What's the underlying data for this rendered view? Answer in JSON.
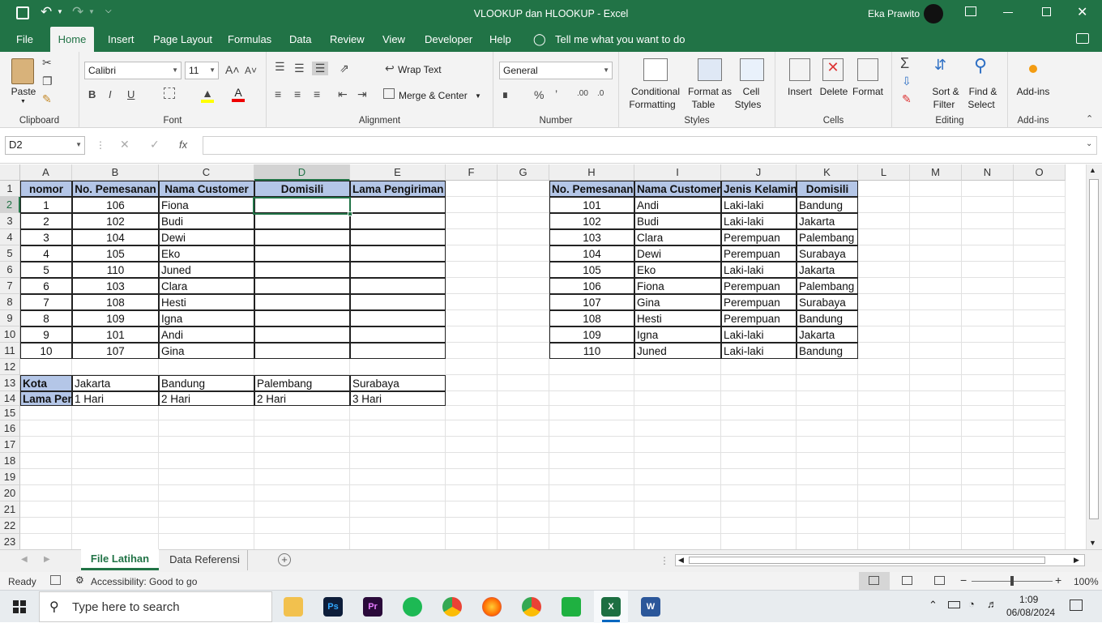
{
  "window": {
    "title": "VLOOKUP dan HLOOKUP  -  Excel",
    "user": "Eka Prawito"
  },
  "ribbon_tabs": [
    "File",
    "Home",
    "Insert",
    "Page Layout",
    "Formulas",
    "Data",
    "Review",
    "View",
    "Developer",
    "Help"
  ],
  "tell_me": "Tell me what you want to do",
  "ribbon": {
    "clipboard": {
      "label": "Clipboard",
      "paste": "Paste"
    },
    "font": {
      "label": "Font",
      "name": "Calibri",
      "size": "11",
      "bold": "B",
      "italic": "I",
      "underline": "U"
    },
    "alignment": {
      "label": "Alignment",
      "wrap": "Wrap Text",
      "merge": "Merge & Center"
    },
    "number": {
      "label": "Number",
      "format": "General"
    },
    "styles": {
      "label": "Styles",
      "conditional": [
        "Conditional",
        "Formatting"
      ],
      "format_table": [
        "Format as",
        "Table"
      ],
      "cell_styles": [
        "Cell",
        "Styles"
      ]
    },
    "cells": {
      "label": "Cells",
      "insert": "Insert",
      "delete": "Delete",
      "format": "Format"
    },
    "editing": {
      "label": "Editing",
      "sort": [
        "Sort &",
        "Filter"
      ],
      "find": [
        "Find &",
        "Select"
      ]
    },
    "addins": {
      "label": "Add-ins",
      "button": "Add-ins"
    }
  },
  "formula_bar": {
    "name_box": "D2",
    "fx": "fx",
    "value": ""
  },
  "columns": [
    "A",
    "B",
    "C",
    "D",
    "E",
    "F",
    "G",
    "H",
    "I",
    "J",
    "K",
    "L",
    "M",
    "N",
    "O"
  ],
  "rows": [
    "1",
    "2",
    "3",
    "4",
    "5",
    "6",
    "7",
    "8",
    "9",
    "10",
    "11",
    "12",
    "13",
    "14",
    "15",
    "16",
    "17",
    "18",
    "19",
    "20",
    "21",
    "22",
    "23"
  ],
  "table1": {
    "headers": [
      "nomor",
      "No. Pemesanan",
      "Nama Customer",
      "Domisili",
      "Lama Pengiriman"
    ],
    "rows": [
      [
        "1",
        "106",
        "Fiona",
        "",
        ""
      ],
      [
        "2",
        "102",
        "Budi",
        "",
        ""
      ],
      [
        "3",
        "104",
        "Dewi",
        "",
        ""
      ],
      [
        "4",
        "105",
        "Eko",
        "",
        ""
      ],
      [
        "5",
        "110",
        "Juned",
        "",
        ""
      ],
      [
        "6",
        "103",
        "Clara",
        "",
        ""
      ],
      [
        "7",
        "108",
        "Hesti",
        "",
        ""
      ],
      [
        "8",
        "109",
        "Igna",
        "",
        ""
      ],
      [
        "9",
        "101",
        "Andi",
        "",
        ""
      ],
      [
        "10",
        "107",
        "Gina",
        "",
        ""
      ]
    ]
  },
  "table2": {
    "headers": [
      "No. Pemesanan",
      "Nama Customer",
      "Jenis Kelamin",
      "Domisili"
    ],
    "rows": [
      [
        "101",
        "Andi",
        "Laki-laki",
        "Bandung"
      ],
      [
        "102",
        "Budi",
        "Laki-laki",
        "Jakarta"
      ],
      [
        "103",
        "Clara",
        "Perempuan",
        "Palembang"
      ],
      [
        "104",
        "Dewi",
        "Perempuan",
        "Surabaya"
      ],
      [
        "105",
        "Eko",
        "Laki-laki",
        "Jakarta"
      ],
      [
        "106",
        "Fiona",
        "Perempuan",
        "Palembang"
      ],
      [
        "107",
        "Gina",
        "Perempuan",
        "Surabaya"
      ],
      [
        "108",
        "Hesti",
        "Perempuan",
        "Bandung"
      ],
      [
        "109",
        "Igna",
        "Laki-laki",
        "Jakarta"
      ],
      [
        "110",
        "Juned",
        "Laki-laki",
        "Bandung"
      ]
    ]
  },
  "table3": {
    "rows": [
      [
        "Kota",
        "Jakarta",
        "Bandung",
        "Palembang",
        "Surabaya"
      ],
      [
        "Lama Pen",
        "1 Hari",
        "2 Hari",
        "2 Hari",
        "3 Hari"
      ]
    ]
  },
  "sheets": [
    "File Latihan",
    "Data Referensi"
  ],
  "status": {
    "ready": "Ready",
    "accessibility": "Accessibility: Good to go",
    "zoom": "100%"
  },
  "taskbar": {
    "search": "Type here to search",
    "time": "1:09",
    "date": "06/08/2024"
  }
}
